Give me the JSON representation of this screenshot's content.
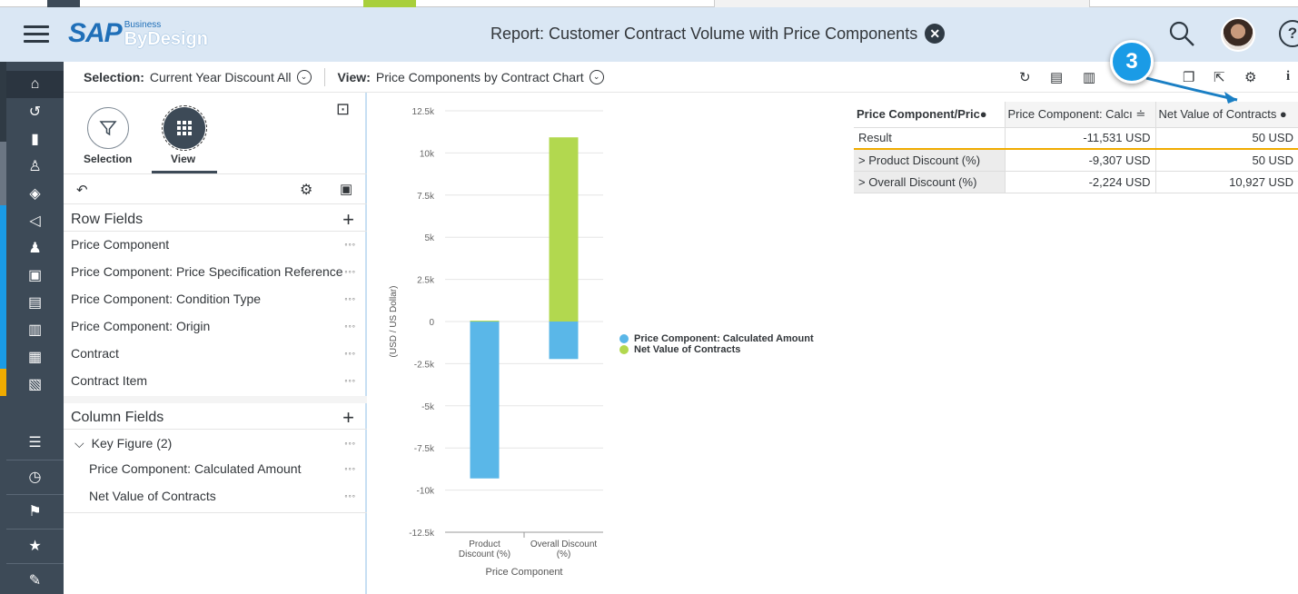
{
  "header": {
    "logo_sap": "SAP",
    "logo_business": "Business",
    "logo_product": "ByDesign",
    "title": "Report: Customer Contract Volume with Price Components"
  },
  "selection_bar": {
    "selection_label": "Selection:",
    "selection_value": "Current Year Discount All",
    "view_label": "View:",
    "view_value": "Price Components by Contract Chart"
  },
  "rail": {
    "icons": [
      "home-icon",
      "recent-icon",
      "analytics-icon",
      "org-icon",
      "product-icon",
      "marketing-icon",
      "people-icon",
      "contact-card-icon",
      "document-icon",
      "document-person-icon",
      "clipboard-icon",
      "invoice-icon"
    ],
    "bottom_icons": [
      "list-icon",
      "clock-icon",
      "flag-icon",
      "favorites-icon",
      "tag-icon"
    ],
    "colors": {
      "blue": "#1a9be6",
      "orange": "#f0ab00",
      "dark": "#3d4a57"
    }
  },
  "pane": {
    "selection_label": "Selection",
    "view_label": "View",
    "row_fields_title": "Row Fields",
    "row_fields": [
      "Price Component",
      "Price Component: Price Specification Reference",
      "Price Component: Condition Type",
      "Price Component: Origin",
      "Contract",
      "Contract Item"
    ],
    "column_fields_title": "Column Fields",
    "key_figure_group": "Key Figure (2)",
    "key_figures": [
      "Price Component: Calculated Amount",
      "Net Value of Contracts"
    ],
    "more_label": "°°°"
  },
  "chart_data": {
    "type": "bar",
    "stacked": true,
    "categories": [
      "Product Discount (%)",
      "Overall Discount (%)"
    ],
    "series": [
      {
        "name": "Price Component: Calculated Amount",
        "color": "#5ab7e8",
        "values": [
          -9307,
          -2224
        ]
      },
      {
        "name": "Net Value of Contracts",
        "color": "#b2d84f",
        "values": [
          50,
          10927
        ]
      }
    ],
    "xlabel": "Price Component",
    "ylabel": "(USD / US Dollar)",
    "ylim": [
      -12500,
      12500
    ],
    "yticks": [
      12500,
      10000,
      7500,
      5000,
      2500,
      0,
      -2500,
      -5000,
      -7500,
      -10000,
      -12500
    ],
    "ytick_labels": [
      "12.5k",
      "10k",
      "7.5k",
      "5k",
      "2.5k",
      "0",
      "-2.5k",
      "-5k",
      "-7.5k",
      "-10k",
      "-12.5k"
    ],
    "x_tick_labels": [
      [
        "Product",
        "Discount (%)"
      ],
      [
        "Overall Discount",
        "(%)"
      ]
    ],
    "legend_position": "right",
    "grid": true
  },
  "table": {
    "headers": [
      "Price Component/Pric●",
      "Price Component: Calcı ≐",
      "Net Value of Contracts ●"
    ],
    "rows": [
      {
        "label": "Result",
        "calc": "-11,531 USD",
        "net": "50 USD"
      },
      {
        "label": "> Product Discount (%)",
        "calc": "-9,307 USD",
        "net": "50 USD"
      },
      {
        "label": "> Overall Discount (%)",
        "calc": "-2,224 USD",
        "net": "10,927 USD"
      }
    ]
  },
  "callout": {
    "number": "3"
  }
}
